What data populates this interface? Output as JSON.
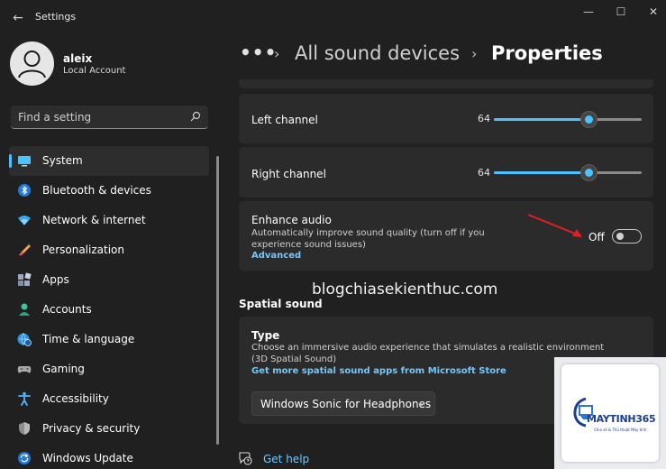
{
  "window": {
    "title": "Settings",
    "back_glyph": "←",
    "min_glyph": "—",
    "max_glyph": "☐",
    "close_glyph": "✕"
  },
  "profile": {
    "name": "aleix",
    "account_type": "Local Account"
  },
  "search": {
    "placeholder": "Find a setting"
  },
  "sidebar": {
    "items": [
      {
        "label": "System",
        "icon": "monitor-icon",
        "active": true
      },
      {
        "label": "Bluetooth & devices",
        "icon": "bluetooth-icon"
      },
      {
        "label": "Network & internet",
        "icon": "wifi-icon"
      },
      {
        "label": "Personalization",
        "icon": "brush-icon"
      },
      {
        "label": "Apps",
        "icon": "apps-icon"
      },
      {
        "label": "Accounts",
        "icon": "person-icon"
      },
      {
        "label": "Time & language",
        "icon": "globe-clock-icon"
      },
      {
        "label": "Gaming",
        "icon": "gamepad-icon"
      },
      {
        "label": "Accessibility",
        "icon": "accessibility-icon"
      },
      {
        "label": "Privacy & security",
        "icon": "shield-icon"
      },
      {
        "label": "Windows Update",
        "icon": "update-icon"
      }
    ]
  },
  "breadcrumb": {
    "ellipsis": "•••",
    "separator": "›",
    "parent": "All sound devices",
    "current": "Properties"
  },
  "left_channel": {
    "label": "Left channel",
    "value": "64",
    "level": 0.64
  },
  "right_channel": {
    "label": "Right channel",
    "value": "64",
    "level": 0.64
  },
  "enhance_audio": {
    "title": "Enhance audio",
    "description": "Automatically improve sound quality (turn off if you experience sound issues)",
    "link": "Advanced",
    "state": "Off"
  },
  "watermark": "blogchiasekienthuc.com",
  "spatial_sound": {
    "section_title": "Spatial sound",
    "type_title": "Type",
    "type_description": "Choose an immersive audio experience that simulates a realistic environment (3D Spatial Sound)",
    "store_link": "Get more spatial sound apps from Microsoft Store",
    "selected": "Windows Sonic for Headphones",
    "chevron": "⌄"
  },
  "help": {
    "label": "Get help"
  },
  "logo": {
    "brand": "MAYTINH365",
    "tagline": "Chia sẻ & Thủ thuật Máy tính"
  },
  "colors": {
    "accent": "#4cc2ff",
    "link": "#6fc9ff",
    "background": "#202020",
    "card": "#2b2b2b",
    "annotation": "#e02020"
  }
}
